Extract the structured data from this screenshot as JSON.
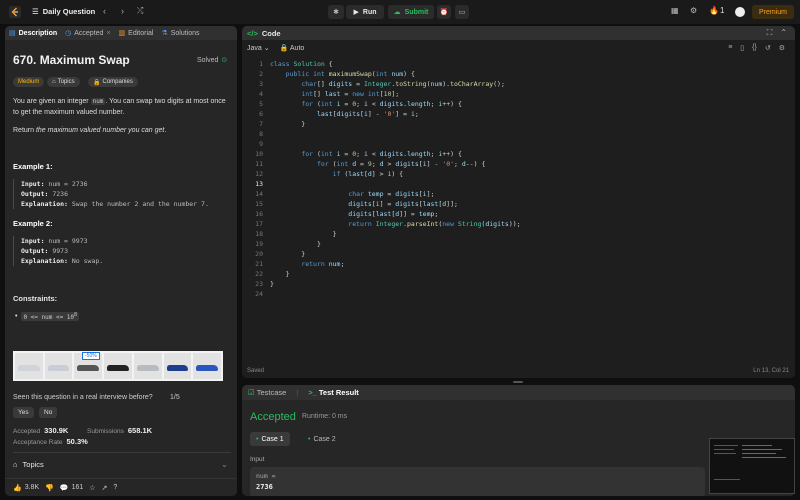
{
  "topbar": {
    "title": "Daily Question",
    "run_label": "Run",
    "submit_label": "Submit",
    "streak": "1",
    "premium_label": "Premium"
  },
  "problem": {
    "tabs": [
      {
        "label": "Description"
      },
      {
        "label": "Accepted"
      },
      {
        "label": "Editorial"
      },
      {
        "label": "Solutions"
      }
    ],
    "title": "670. Maximum Swap",
    "status": "Solved",
    "difficulty": "Medium",
    "topics_label": "Topics",
    "companies_label": "Companies",
    "desc_p1_a": "You are given an integer ",
    "desc_p1_code": "num",
    "desc_p1_b": ". You can swap two digits at most once to get the maximum valued number.",
    "desc_p2_a": "Return ",
    "desc_p2_em": "the maximum valued number you can get",
    "desc_p2_b": ".",
    "examples": [
      {
        "title": "Example 1:",
        "input_label": "Input:",
        "input": "num = 2736",
        "output_label": "Output:",
        "output": "7236",
        "explanation_label": "Explanation:",
        "explanation": "Swap the number 2 and the number 7."
      },
      {
        "title": "Example 2:",
        "input_label": "Input:",
        "input": "num = 9973",
        "output_label": "Output:",
        "output": "9973",
        "explanation_label": "Explanation:",
        "explanation": "No swap."
      }
    ],
    "constraints_title": "Constraints:",
    "constraint": "0 <= num <= 10",
    "constraint_exp": "8",
    "ad_badge": "-50%",
    "seen_question": "Seen this question in a real interview before?",
    "seen_pager": "1/5",
    "yes_label": "Yes",
    "no_label": "No",
    "accepted_label": "Accepted",
    "accepted_value": "330.9K",
    "submissions_label": "Submissions",
    "submissions_value": "658.1K",
    "acceptance_label": "Acceptance Rate",
    "acceptance_value": "50.3%",
    "topics_section": "Topics",
    "likes": "3.8K",
    "comments": "161"
  },
  "editor": {
    "title": "Code",
    "language": "Java",
    "autosave": "Auto",
    "saved": "Saved",
    "cursor": "Ln 13, Col 21",
    "current_line": 13
  },
  "tests": {
    "tab_testcase": "Testcase",
    "tab_result": "Test Result",
    "verdict": "Accepted",
    "runtime": "Runtime: 0 ms",
    "case1": "Case 1",
    "case2": "Case 2",
    "input_label": "Input",
    "input_name": "num =",
    "input_value": "2736"
  },
  "colors": {
    "accent_green": "#2cbb5d",
    "accent_orange": "#ffa116",
    "medium_yellow": "#ffb800"
  }
}
